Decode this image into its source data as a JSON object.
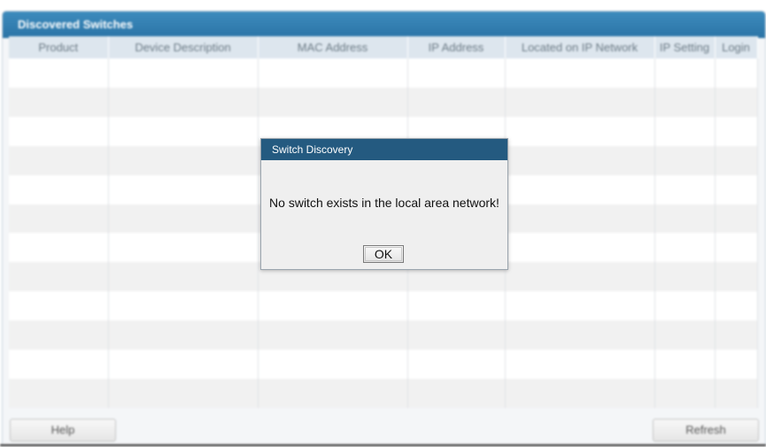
{
  "panel": {
    "title": "Discovered Switches"
  },
  "table": {
    "columns": [
      "Product",
      "Device Description",
      "MAC Address",
      "IP Address",
      "Located on IP Network",
      "IP Setting",
      "Login"
    ],
    "rows": []
  },
  "buttons": {
    "help": "Help",
    "refresh": "Refresh"
  },
  "dialog": {
    "title": "Switch Discovery",
    "message": "No switch exists in the local area network!",
    "ok": "OK"
  }
}
